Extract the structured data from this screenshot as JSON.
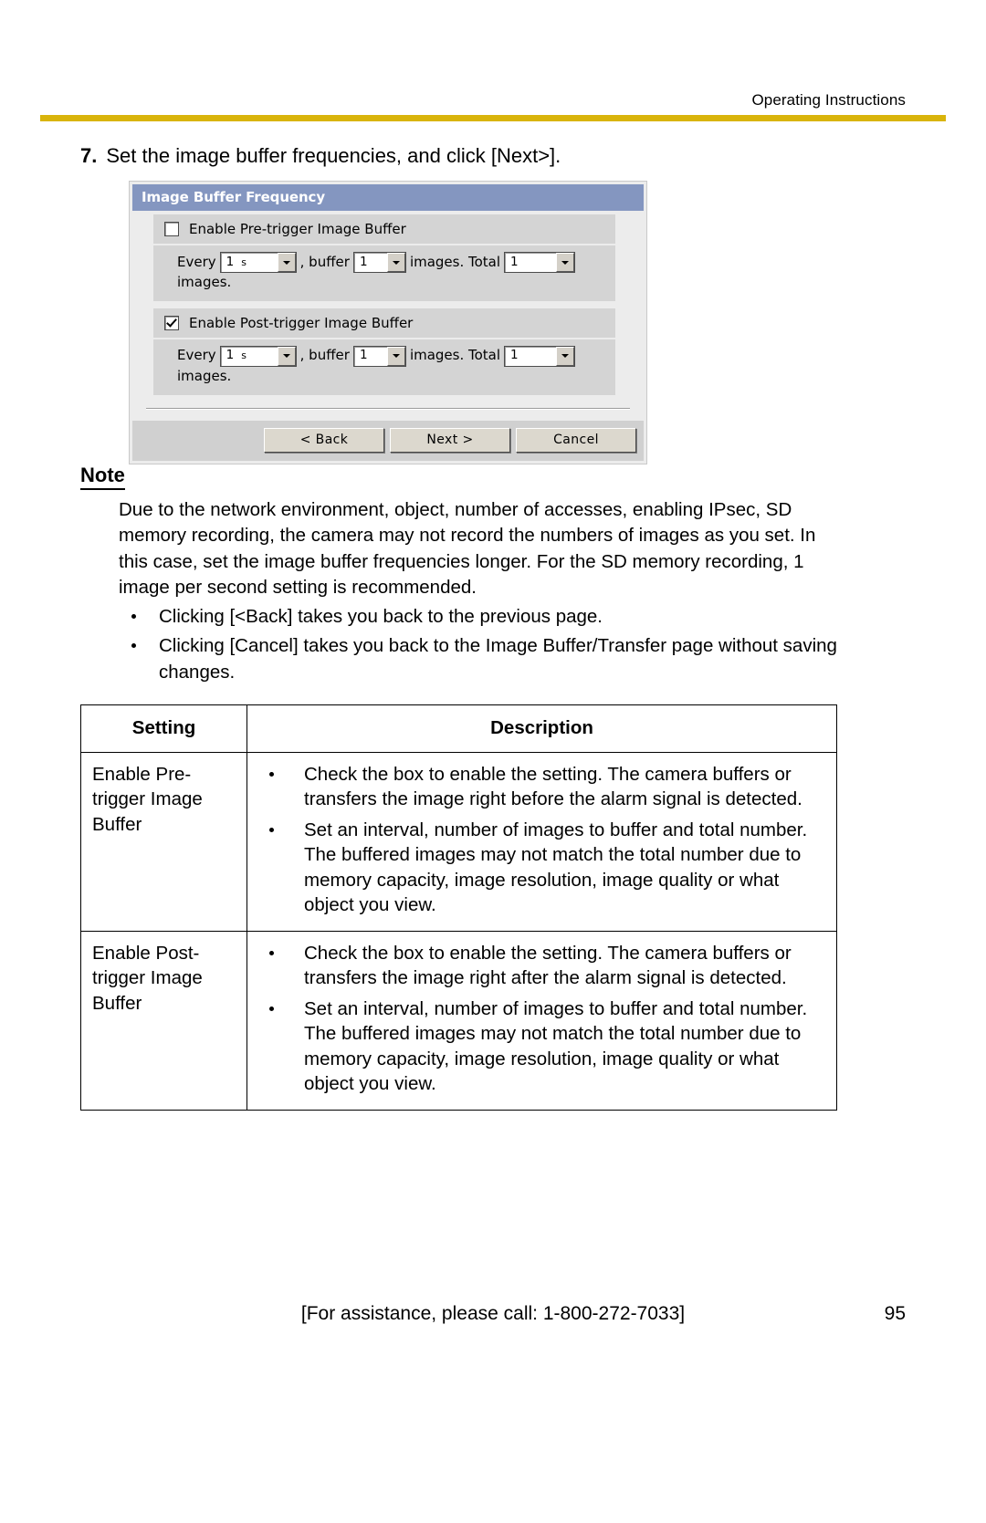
{
  "header": {
    "title": "Operating Instructions"
  },
  "step": {
    "number": "7.",
    "text": "Set the image buffer frequencies, and click [Next>]."
  },
  "dialog": {
    "title": "Image Buffer Frequency",
    "pre": {
      "checkbox_label": "Enable Pre-trigger Image Buffer",
      "checked": false,
      "every_label": "Every",
      "every_value": "1",
      "every_unit": "s",
      "buffer_label": ", buffer",
      "buffer_value": "1",
      "images_label": "images. Total",
      "total_value": "1",
      "trailing_label": "images."
    },
    "post": {
      "checkbox_label": "Enable Post-trigger Image Buffer",
      "checked": true,
      "every_label": "Every",
      "every_value": "1",
      "every_unit": "s",
      "buffer_label": ", buffer",
      "buffer_value": "1",
      "images_label": "images. Total",
      "total_value": "1",
      "trailing_label": "images."
    },
    "buttons": {
      "back": "< Back",
      "next": "Next >",
      "cancel": "Cancel"
    }
  },
  "note": {
    "heading": "Note",
    "paragraph": "Due to the network environment, object, number of accesses, enabling IPsec, SD memory recording, the camera may not record the numbers of images as you set. In this case, set the image buffer frequencies longer. For the SD memory recording, 1 image per second setting is recommended.",
    "bullets": [
      "Clicking [<Back] takes you back to the previous page.",
      "Clicking [Cancel] takes you back to the Image Buffer/Transfer page without saving changes."
    ]
  },
  "table": {
    "headers": {
      "setting": "Setting",
      "description": "Description"
    },
    "rows": [
      {
        "setting": "Enable Pre-trigger Image Buffer",
        "bullets": [
          "Check the box to enable the setting. The camera buffers or transfers the image right before the alarm signal is detected.",
          "Set an interval, number of images to buffer and total number. The buffered images may not match the total number due to memory capacity, image resolution, image quality or what object you view."
        ]
      },
      {
        "setting": "Enable Post-trigger Image Buffer",
        "bullets": [
          "Check the box to enable the setting. The camera buffers or transfers the image right after the alarm signal is detected.",
          "Set an interval, number of images to buffer and total number. The buffered images may not match the total number due to memory capacity, image resolution, image quality or what object you view."
        ]
      }
    ]
  },
  "footer": {
    "assistance": "[For assistance, please call: 1-800-272-7033]",
    "page": "95"
  },
  "colors": {
    "rule": "#d9b40b",
    "dialog_titlebar": "#8496c0",
    "dialog_section": "#d4d4d4"
  }
}
